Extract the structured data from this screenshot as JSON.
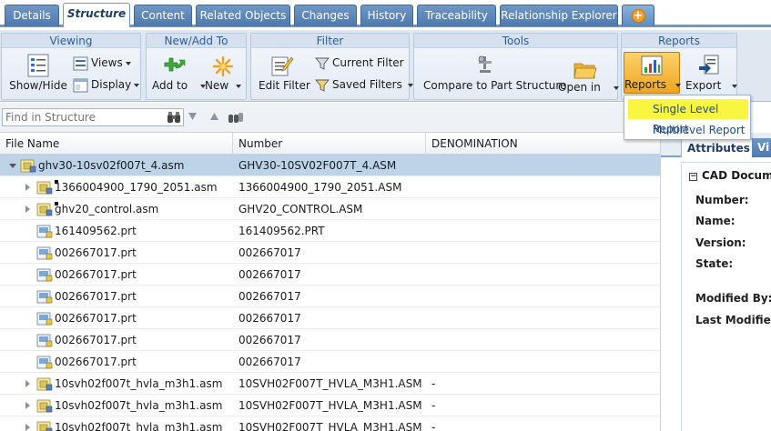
{
  "tabs": [
    {
      "label": "Details",
      "active": false
    },
    {
      "label": "Structure",
      "active": true
    },
    {
      "label": "Content",
      "active": false
    },
    {
      "label": "Related Objects",
      "active": false
    },
    {
      "label": "Changes",
      "active": false
    },
    {
      "label": "History",
      "active": false
    },
    {
      "label": "Traceability",
      "active": false
    },
    {
      "label": "Relationship Explorer",
      "active": false
    }
  ],
  "add_tab_icon": "plus-icon",
  "ribbon": {
    "viewing": {
      "title": "Viewing",
      "show_hide": "Show/Hide",
      "views": "Views",
      "display": "Display"
    },
    "new_add": {
      "title": "New/Add To",
      "add_to": "Add to",
      "new": "New"
    },
    "filter": {
      "title": "Filter",
      "edit_filter": "Edit Filter",
      "current_filter": "Current Filter",
      "saved_filters": "Saved Filters"
    },
    "tools": {
      "title": "Tools",
      "compare": "Compare to Part Structure",
      "open_in": "Open in"
    },
    "reports": {
      "title": "Reports",
      "reports": "Reports",
      "export": "Export"
    }
  },
  "reports_menu": [
    {
      "label": "Single Level Report",
      "highlighted": true
    },
    {
      "label": "Multilevel Report",
      "highlighted": false
    }
  ],
  "search": {
    "placeholder": "Find in Structure",
    "value": ""
  },
  "columns": [
    "File Name",
    "Number",
    "DENOMINATION"
  ],
  "rows": [
    {
      "name": "ghv30-10sv02f007t_4.asm",
      "number": "GHV30-10SV02F007T_4.ASM",
      "denomination": "",
      "level": 0,
      "expander": "open",
      "icon": "assembly-icon",
      "selected": true
    },
    {
      "name": "1366004900_1790_2051.asm",
      "number": "1366004900_1790_2051.ASM",
      "denomination": "",
      "level": 1,
      "expander": "closed",
      "icon": "assembly-icon",
      "selected": false
    },
    {
      "name": "ghv20_control.asm",
      "number": "GHV20_CONTROL.ASM",
      "denomination": "",
      "level": 1,
      "expander": "closed",
      "icon": "assembly-icon",
      "selected": false
    },
    {
      "name": "161409562.prt",
      "number": "161409562.PRT",
      "denomination": "",
      "level": 1,
      "expander": "none",
      "icon": "part-icon",
      "selected": false
    },
    {
      "name": "002667017.prt",
      "number": "002667017",
      "denomination": "",
      "level": 1,
      "expander": "none",
      "icon": "part-icon",
      "selected": false
    },
    {
      "name": "002667017.prt",
      "number": "002667017",
      "denomination": "",
      "level": 1,
      "expander": "none",
      "icon": "part-icon",
      "selected": false
    },
    {
      "name": "002667017.prt",
      "number": "002667017",
      "denomination": "",
      "level": 1,
      "expander": "none",
      "icon": "part-icon",
      "selected": false
    },
    {
      "name": "002667017.prt",
      "number": "002667017",
      "denomination": "",
      "level": 1,
      "expander": "none",
      "icon": "part-icon",
      "selected": false
    },
    {
      "name": "002667017.prt",
      "number": "002667017",
      "denomination": "",
      "level": 1,
      "expander": "none",
      "icon": "part-icon",
      "selected": false
    },
    {
      "name": "002667017.prt",
      "number": "002667017",
      "denomination": "",
      "level": 1,
      "expander": "none",
      "icon": "part-icon",
      "selected": false
    },
    {
      "name": "10svh02f007t_hvla_m3h1.asm",
      "number": "10SVH02F007T_HVLA_M3H1.ASM",
      "denomination": "-",
      "level": 1,
      "expander": "closed",
      "icon": "assembly-icon",
      "selected": false
    },
    {
      "name": "10svh02f007t_hvla_m3h1.asm",
      "number": "10SVH02F007T_HVLA_M3H1.ASM",
      "denomination": "-",
      "level": 1,
      "expander": "closed",
      "icon": "assembly-icon",
      "selected": false
    },
    {
      "name": "10svh02f007t_hvla_m3h1.asm",
      "number": "10SVH02F007T_HVLA_M3H1.ASM",
      "denomination": "-",
      "level": 1,
      "expander": "closed",
      "icon": "assembly-icon",
      "selected": false
    }
  ],
  "right_panel": {
    "tabs": [
      "Attributes",
      "Vi"
    ],
    "section": "CAD Docume",
    "fields": [
      "Number:",
      "Name:",
      "Version:",
      "State:",
      "Modified By:",
      "Last Modified:"
    ]
  },
  "colors": {
    "tab_blue": "#4e79ad",
    "group_title": "#2f5b92",
    "highlight_yellow": "#f8f640",
    "selected_row": "#bcd3e8"
  }
}
